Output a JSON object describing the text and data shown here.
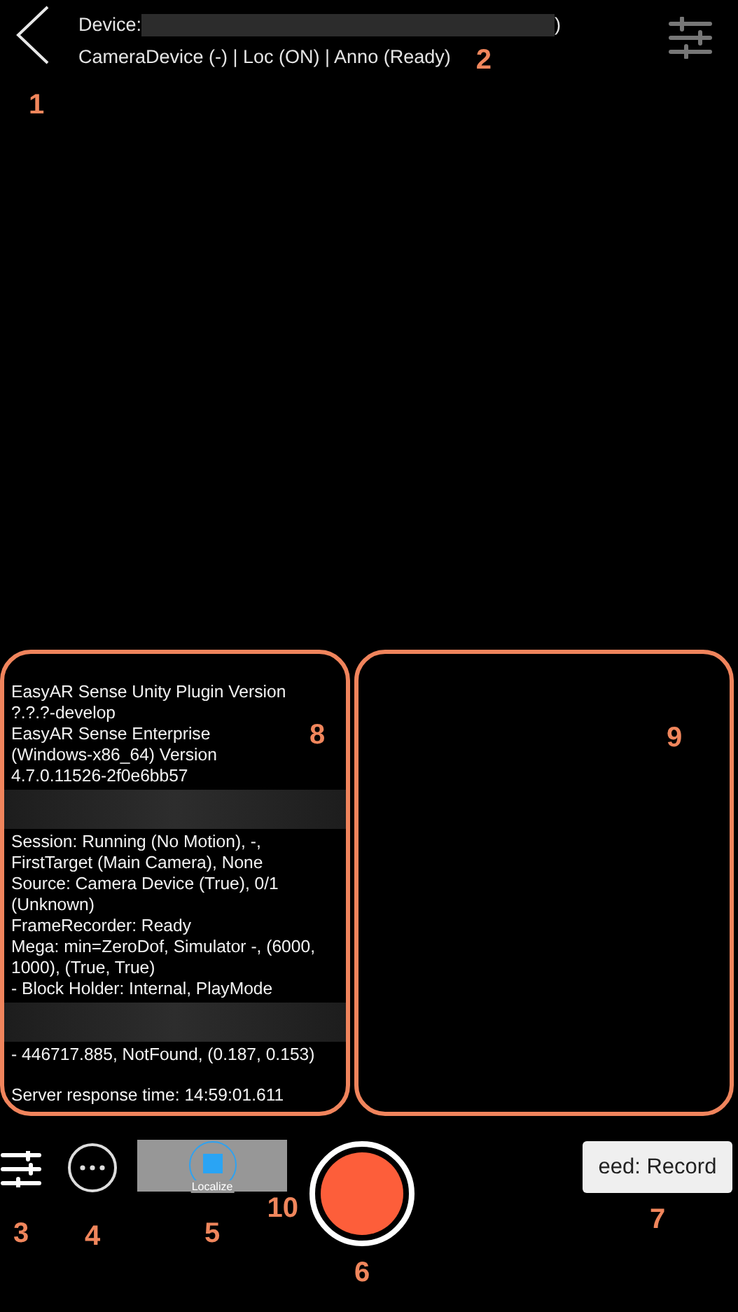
{
  "header": {
    "back_marker": "1",
    "device_label": "Device:",
    "device_suffix": ")",
    "status": "CameraDevice (-) | Loc (ON) | Anno (Ready)",
    "marker": "2"
  },
  "info_panel": {
    "marker": "8",
    "blocks": [
      {
        "kind": "text",
        "lines": [
          "EasyAR Sense Unity Plugin Version",
          "?.?.?-develop",
          "EasyAR Sense Enterprise",
          "(Windows-x86_64) Version",
          "4.7.0.11526-2f0e6bb57"
        ]
      },
      {
        "kind": "redacted"
      },
      {
        "kind": "text",
        "lines": [
          "Session: Running (No Motion), -,",
          "FirstTarget (Main Camera), None",
          "Source: Camera Device (True), 0/1",
          "(Unknown)",
          "FrameRecorder: Ready",
          "Mega: min=ZeroDof, Simulator -, (6000,",
          "1000), (True, True)",
          "- Block Holder: Internal, PlayMode"
        ]
      },
      {
        "kind": "redacted"
      },
      {
        "kind": "text",
        "lines": [
          "- 446717.885, NotFound, (0.187, 0.153)"
        ]
      },
      {
        "kind": "gap"
      },
      {
        "kind": "text",
        "lines": [
          "Server response time: 14:59:01.611"
        ]
      }
    ]
  },
  "side_panel": {
    "marker": "9"
  },
  "toolbar": [
    {
      "kind": "sliders",
      "marker": "3"
    },
    {
      "kind": "more",
      "marker": "4"
    },
    {
      "kind": "localize",
      "label": "Localize",
      "marker": "5",
      "extra_marker": "10"
    },
    {
      "kind": "record",
      "marker": "6"
    },
    {
      "kind": "mode",
      "label": "eed: Record",
      "marker": "7"
    }
  ]
}
